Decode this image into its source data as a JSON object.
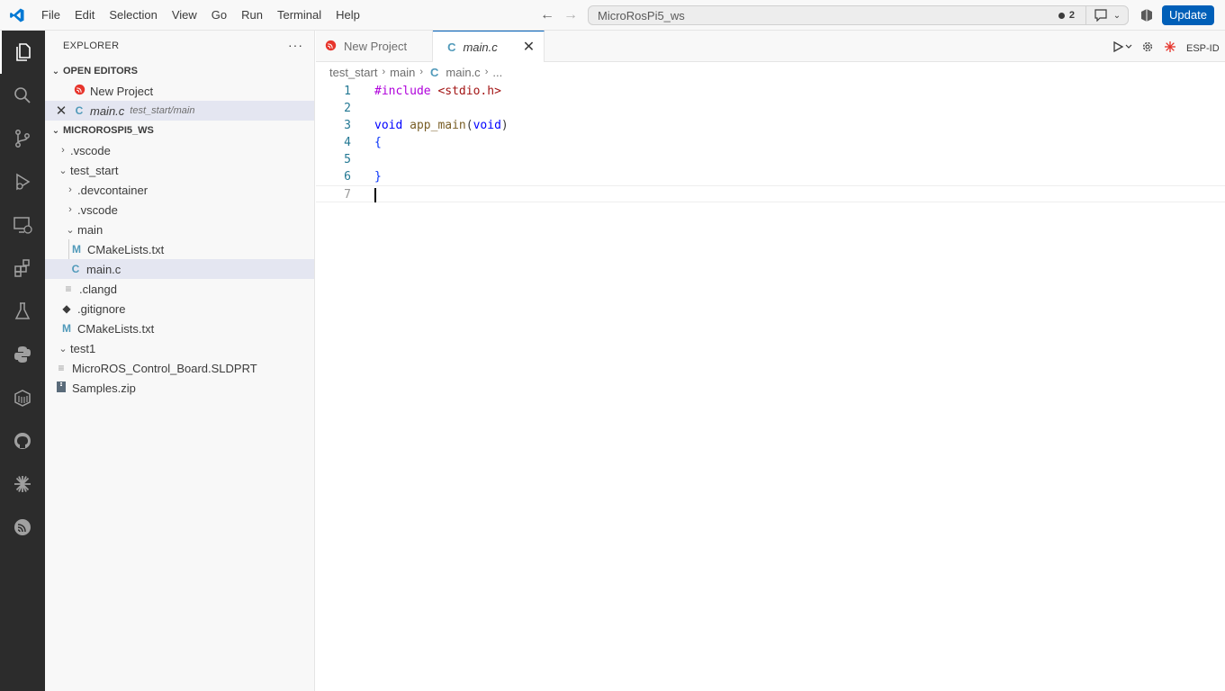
{
  "titlebar": {
    "menu": [
      "File",
      "Edit",
      "Selection",
      "View",
      "Go",
      "Run",
      "Terminal",
      "Help"
    ],
    "back_icon": "arrow-left",
    "forward_icon": "arrow-right",
    "search_text": "MicroRosPi5_ws",
    "notification_count": "2",
    "update_label": "Update",
    "accent_color": "#005fb8"
  },
  "activitybar": {
    "icons": [
      "files-icon",
      "search-icon",
      "source-control-icon",
      "run-debug-icon",
      "remote-explorer-icon",
      "extensions-icon",
      "testing-icon",
      "python-icon",
      "containers-icon",
      "github-icon",
      "espidf-icon",
      "espressif-icon"
    ]
  },
  "sidebar": {
    "title": "EXPLORER",
    "more": "···",
    "open_editors": {
      "label": "OPEN EDITORS",
      "items": [
        {
          "name": "New Project",
          "desc": ""
        },
        {
          "name": "main.c",
          "desc": "test_start/main"
        }
      ]
    },
    "workspace": {
      "label": "MICROROSPI5_WS",
      "items": [
        {
          "name": ".vscode"
        },
        {
          "name": "test_start"
        },
        {
          "name": ".devcontainer"
        },
        {
          "name": ".vscode"
        },
        {
          "name": "main"
        },
        {
          "name": "CMakeLists.txt"
        },
        {
          "name": "main.c"
        },
        {
          "name": ".clangd"
        },
        {
          "name": ".gitignore"
        },
        {
          "name": "CMakeLists.txt"
        },
        {
          "name": "test1"
        },
        {
          "name": "MicroROS_Control_Board.SLDPRT"
        },
        {
          "name": "Samples.zip"
        }
      ]
    }
  },
  "editor": {
    "tabs": [
      {
        "label": "New Project",
        "active": false
      },
      {
        "label": "main.c",
        "active": true
      }
    ],
    "actions_label": "ESP-ID",
    "breadcrumbs": [
      "test_start",
      "main",
      "main.c",
      "..."
    ],
    "lines": [
      {
        "num": "1",
        "parts": [
          [
            "#include ",
            "kw-inc"
          ],
          [
            "<stdio.h>",
            "str"
          ]
        ]
      },
      {
        "num": "2",
        "parts": []
      },
      {
        "num": "3",
        "parts": [
          [
            "void",
            "kw"
          ],
          [
            " ",
            ""
          ],
          [
            "app_main",
            "fn"
          ],
          [
            "(",
            ""
          ],
          [
            "void",
            "kw"
          ],
          [
            ")",
            ""
          ]
        ]
      },
      {
        "num": "4",
        "parts": [
          [
            "{",
            "brace"
          ]
        ]
      },
      {
        "num": "5",
        "parts": []
      },
      {
        "num": "6",
        "parts": [
          [
            "}",
            "brace"
          ]
        ]
      },
      {
        "num": "7",
        "parts": []
      }
    ],
    "code_text": [
      "#include <stdio.h>",
      "",
      "void app_main(void)",
      "{",
      "",
      "}",
      ""
    ]
  }
}
